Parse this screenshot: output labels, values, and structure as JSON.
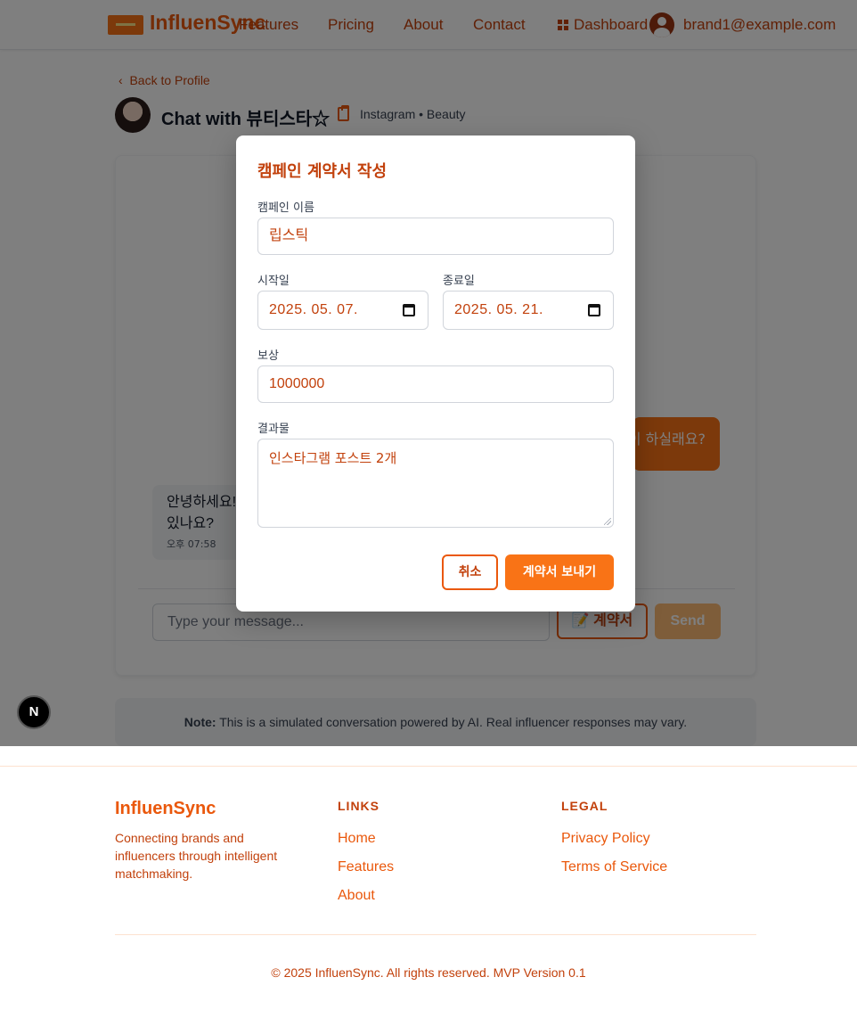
{
  "header": {
    "brand": "InfluenSync",
    "nav": [
      "Features",
      "Pricing",
      "About",
      "Contact"
    ],
    "dashboard": "Dashboard",
    "user_email": "brand1@example.com"
  },
  "chat": {
    "back_link": "Back to Profile",
    "title": "Chat with 뷰티스타☆",
    "platform": "Instagram • Beauty",
    "outgoing_message": "이 하실래요?",
    "incoming_message": "안녕하세요! \n있나요?",
    "incoming_time": "오후 07:58",
    "input_placeholder": "Type your message...",
    "contract_button": "📝 계약서",
    "send_button": "Send"
  },
  "note": {
    "label": "Note:",
    "text": " This is a simulated conversation powered by AI. Real influencer responses may vary."
  },
  "next_badge": "N",
  "footer": {
    "brand": "InfluenSync",
    "tagline": "Connecting brands and influencers through intelligent matchmaking.",
    "links_heading": "LINKS",
    "links": [
      "Home",
      "Features",
      "About"
    ],
    "legal_heading": "LEGAL",
    "legal": [
      "Privacy Policy",
      "Terms of Service"
    ],
    "copyright": "© 2025 InfluenSync. All rights reserved. MVP Version 0.1"
  },
  "modal": {
    "title": "캠페인 계약서 작성",
    "campaign_name_label": "캠페인 이름",
    "campaign_name_value": "립스틱",
    "start_label": "시작일",
    "start_value": "2025. 05. 07.",
    "end_label": "종료일",
    "end_value": "2025. 05. 21.",
    "reward_label": "보상",
    "reward_value": "1000000",
    "deliverable_label": "결과물",
    "deliverable_value": "인스타그램 포스트 2개",
    "cancel_button": "취소",
    "send_button": "계약서 보내기"
  },
  "colors": {
    "accent": "#f97316",
    "accent_dark": "#c2410c"
  }
}
